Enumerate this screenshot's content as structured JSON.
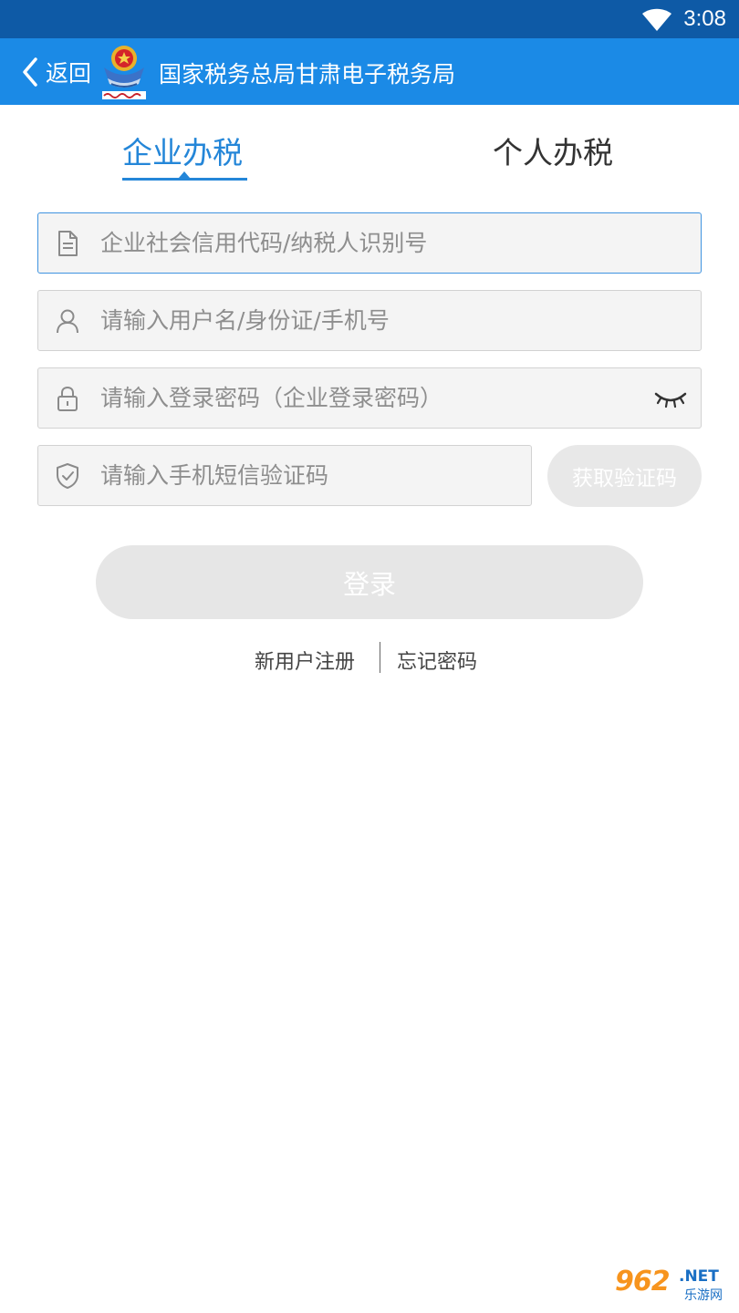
{
  "status_bar": {
    "time": "3:08",
    "wifi_icon": "wifi-icon"
  },
  "app_bar": {
    "back_label": "返回",
    "title": "国家税务总局甘肃电子税务局",
    "emblem_icon": "tax-emblem-icon",
    "color": "#1b8ae6"
  },
  "tabs": [
    {
      "label": "企业办税",
      "active": true
    },
    {
      "label": "个人办税",
      "active": false
    }
  ],
  "form": {
    "credit_code_placeholder": "企业社会信用代码/纳税人识别号",
    "username_placeholder": "请输入用户名/身份证/手机号",
    "password_placeholder": "请输入登录密码（企业登录密码）",
    "sms_code_placeholder": "请输入手机短信验证码",
    "get_code_label": "获取验证码",
    "login_label": "登录"
  },
  "links": {
    "register": "新用户注册",
    "forgot": "忘记密码"
  },
  "watermark": {
    "number": "962",
    "domain": ".NET",
    "text": "乐游网"
  },
  "colors": {
    "accent": "#2486d8",
    "status_bar": "#0e5aa6",
    "disabled_button": "#e6e6e6"
  }
}
